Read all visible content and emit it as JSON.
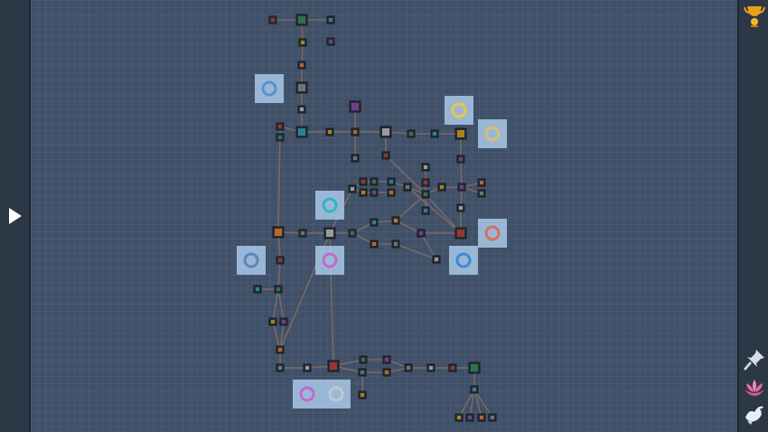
{
  "window": {
    "title": ""
  },
  "left_panel": {
    "expand_icon": "triangle-right-icon"
  },
  "right_panel": {
    "icons": [
      "gold-trophy-icon",
      "pin-icon",
      "pink-lotus-icon",
      "white-bird-icon"
    ],
    "colors": {
      "trophy": "#e8a21a",
      "pin": "#d8dde4",
      "lotus": "#e86aa0",
      "bird": "#e9eef4"
    }
  },
  "skill_tree": {
    "line_color": "#7a6a64",
    "node_fill": "#2a2f36",
    "preview_colors": [
      "#5a8fd0",
      "#e8c64a",
      "#2fb6c6",
      "#d47060",
      "#c06ad0",
      "#3a8ad8"
    ]
  }
}
